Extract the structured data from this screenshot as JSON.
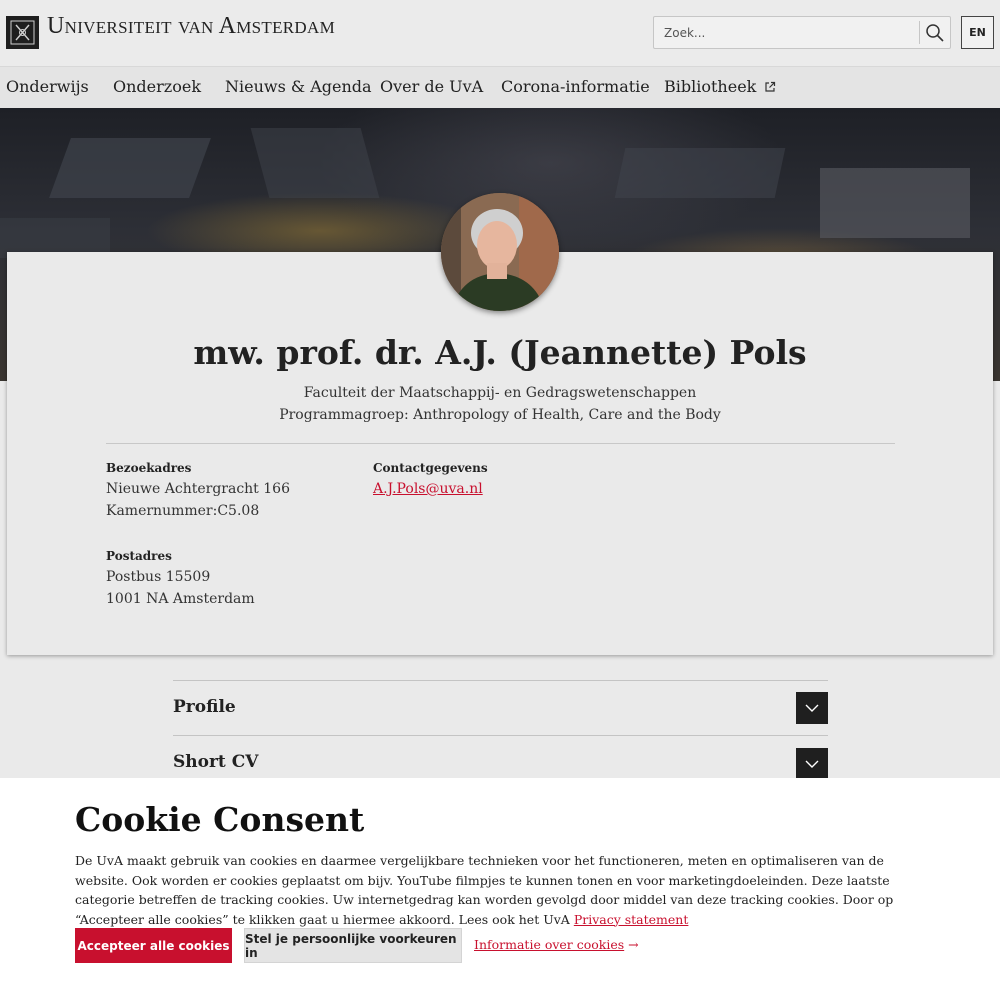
{
  "header": {
    "logo_text": "Universiteit van Amsterdam",
    "search_placeholder": "Zoek...",
    "lang": "EN"
  },
  "nav": {
    "items": [
      {
        "label": "Onderwijs"
      },
      {
        "label": "Onderzoek"
      },
      {
        "label": "Nieuws & Agenda"
      },
      {
        "label": "Over de UvA"
      },
      {
        "label": "Corona-informatie"
      },
      {
        "label": "Bibliotheek",
        "icon": "external-link-icon"
      }
    ]
  },
  "profile": {
    "name": "mw. prof. dr. A.J. (Jeannette) Pols",
    "faculty": "Faculteit der Maatschappij- en Gedragswetenschappen",
    "program": "Programmagroep: Anthropology of Health, Care and the Body",
    "visit": {
      "label": "Bezoekadres",
      "line1": "Nieuwe Achtergracht 166",
      "line2": "Kamernummer:C5.08"
    },
    "contact": {
      "label": "Contactgegevens",
      "email": "A.J.Pols@uva.nl"
    },
    "postal": {
      "label": "Postadres",
      "line1": "Postbus 15509",
      "line2": "1001 NA Amsterdam"
    }
  },
  "accordion": [
    {
      "title": "Profile",
      "icon": "chevron-down-icon"
    },
    {
      "title": "Short CV",
      "icon": "chevron-down-icon"
    }
  ],
  "cookie": {
    "title": "Cookie Consent",
    "text": "De UvA maakt gebruik van cookies en daarmee vergelijkbare technieken voor het functioneren, meten en optimaliseren van de website. Ook worden er cookies geplaatst om bijv. YouTube filmpjes te kunnen tonen en voor marketingdoeleinden. Deze laatste categorie betreffen de tracking cookies. Uw internetgedrag kan worden gevolgd door middel van deze tracking cookies. Door op “Accepteer alle cookies” te klikken gaat u hiermee akkoord. Lees ook het UvA",
    "privacy_link": "Privacy statement",
    "accept_label": "Accepteer alle cookies",
    "prefs_label": "Stel je persoonlijke voorkeuren in",
    "info_label": "Informatie over cookies",
    "info_arrow": "→"
  },
  "colors": {
    "brand_red": "#c8102e",
    "dark": "#1f1f1f"
  }
}
